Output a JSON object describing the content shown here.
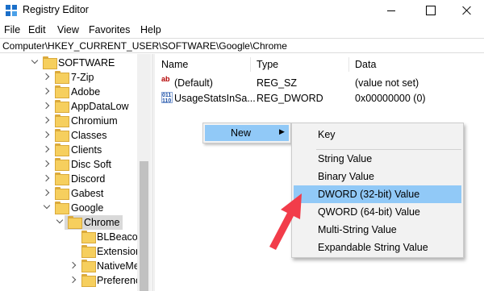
{
  "window": {
    "title": "Registry Editor"
  },
  "menubar": {
    "items": [
      "File",
      "Edit",
      "View",
      "Favorites",
      "Help"
    ]
  },
  "address": {
    "path": "Computer\\HKEY_CURRENT_USER\\SOFTWARE\\Google\\Chrome"
  },
  "tree": {
    "root": "SOFTWARE",
    "children": [
      "7-Zip",
      "Adobe",
      "AppDataLow",
      "Chromium",
      "Classes",
      "Clients",
      "Disc Soft",
      "Discord",
      "Gabest",
      "Google"
    ],
    "selected": "Chrome",
    "grandchildren": [
      "BLBeacor",
      "Extension",
      "NativeMe",
      "Preferenc"
    ]
  },
  "list": {
    "columns": [
      "Name",
      "Type",
      "Data"
    ],
    "rows": [
      {
        "name": "(Default)",
        "type": "REG_SZ",
        "data": "(value not set)",
        "icon": "string-value-icon"
      },
      {
        "name": "UsageStatsInSa...",
        "type": "REG_DWORD",
        "data": "0x00000000 (0)",
        "icon": "binary-value-icon"
      }
    ]
  },
  "context_menu": {
    "new_label": "New",
    "submenu": {
      "key": "Key",
      "items": [
        "String Value",
        "Binary Value",
        "DWORD (32-bit) Value",
        "QWORD (64-bit) Value",
        "Multi-String Value",
        "Expandable String Value"
      ],
      "highlighted": "DWORD (32-bit) Value"
    }
  },
  "colors": {
    "highlight": "#91c9f7",
    "annotation_arrow": "#f23c4a",
    "folder": "#f6cf5e"
  }
}
